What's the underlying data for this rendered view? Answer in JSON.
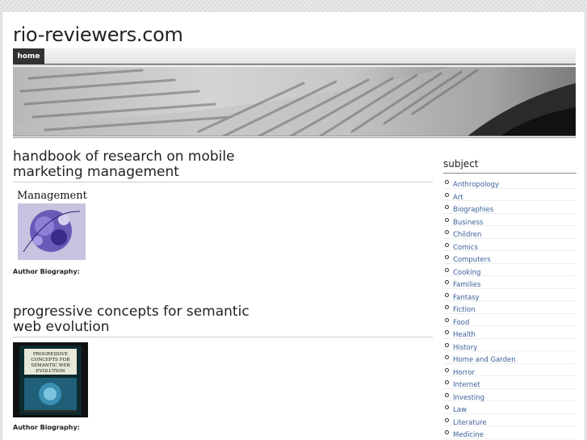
{
  "site": {
    "title": "rio-reviewers.com"
  },
  "nav": {
    "items": [
      {
        "label": "home"
      }
    ]
  },
  "posts": [
    {
      "title": "handbook of research on mobile marketing management",
      "cover_text": "Management",
      "author_bio_label": "Author Biography:"
    },
    {
      "title": "progressive concepts for semantic web evolution",
      "cover_text": "PROGRESSIVE CONCEPTS FOR SEMANTIC WEB EVOLUTION",
      "author_bio_label": "Author Biography:"
    }
  ],
  "sidebar": {
    "title": "subject",
    "categories": [
      "Anthropology",
      "Art",
      "Biographies",
      "Business",
      "Children",
      "Comics",
      "Computers",
      "Cooking",
      "Families",
      "Fantasy",
      "Fiction",
      "Food",
      "Health",
      "History",
      "Home and Garden",
      "Horror",
      "Internet",
      "Investing",
      "Law",
      "Literature",
      "Medicine"
    ]
  },
  "colors": {
    "link": "#3a5f99",
    "nav_active": "#333333"
  }
}
